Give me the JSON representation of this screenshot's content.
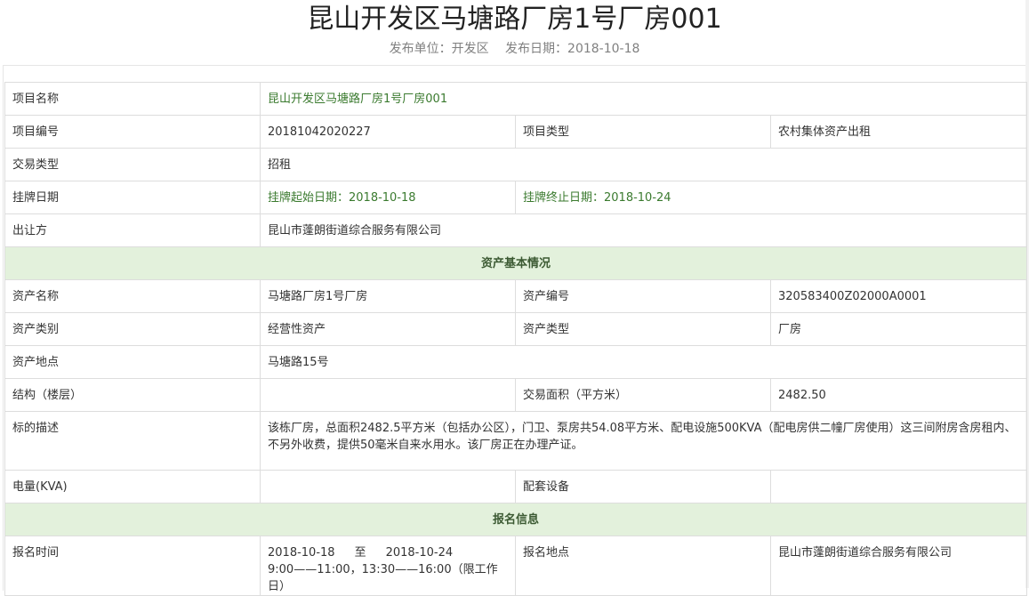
{
  "header": {
    "title": "昆山开发区马塘路厂房1号厂房001",
    "publisher_label": "发布单位：开发区",
    "date_label": "发布日期：2018-10-18"
  },
  "project": {
    "name_label": "项目名称",
    "name_value": "昆山开发区马塘路厂房1号厂房001",
    "code_label": "项目编号",
    "code_value": "20181042020227",
    "type_label": "项目类型",
    "type_value": "农村集体资产出租",
    "trade_type_label": "交易类型",
    "trade_type_value": "招租",
    "listing_label": "挂牌日期",
    "listing_start": "挂牌起始日期：2018-10-18",
    "listing_end": "挂牌终止日期：2018-10-24",
    "transferor_label": "出让方",
    "transferor_value": "昆山市蓬朗街道综合服务有限公司"
  },
  "asset": {
    "section_title": "资产基本情况",
    "name_label": "资产名称",
    "name_value": "马塘路厂房1号厂房",
    "code_label": "资产编号",
    "code_value": "320583400Z02000A0001",
    "category_label": "资产类别",
    "category_value": "经营性资产",
    "type_label": "资产类型",
    "type_value": "厂房",
    "location_label": "资产地点",
    "location_value": "马塘路15号",
    "structure_label": "结构（楼层）",
    "structure_value": "",
    "area_label": "交易面积（平方米）",
    "area_value": "2482.50",
    "desc_label": "标的描述",
    "desc_value": "该栋厂房，总面积2482.5平方米（包括办公区），门卫、泵房共54.08平方米、配电设施500KVA（配电房供二幢厂房使用）这三间附房含房租内、不另外收费，提供50毫米自来水用水。该厂房正在办理产证。",
    "power_label": "电量(KVA)",
    "power_value": "",
    "equipment_label": "配套设备",
    "equipment_value": ""
  },
  "registration": {
    "section_title": "报名信息",
    "time_label": "报名时间",
    "date_from": "2018-10-18",
    "date_to_word": "至",
    "date_to": "2018-10-24",
    "hours": "9:00——11:00，13:30——16:00（限工作日）",
    "place_label": "报名地点",
    "place_value": "昆山市蓬朗街道综合服务有限公司"
  }
}
